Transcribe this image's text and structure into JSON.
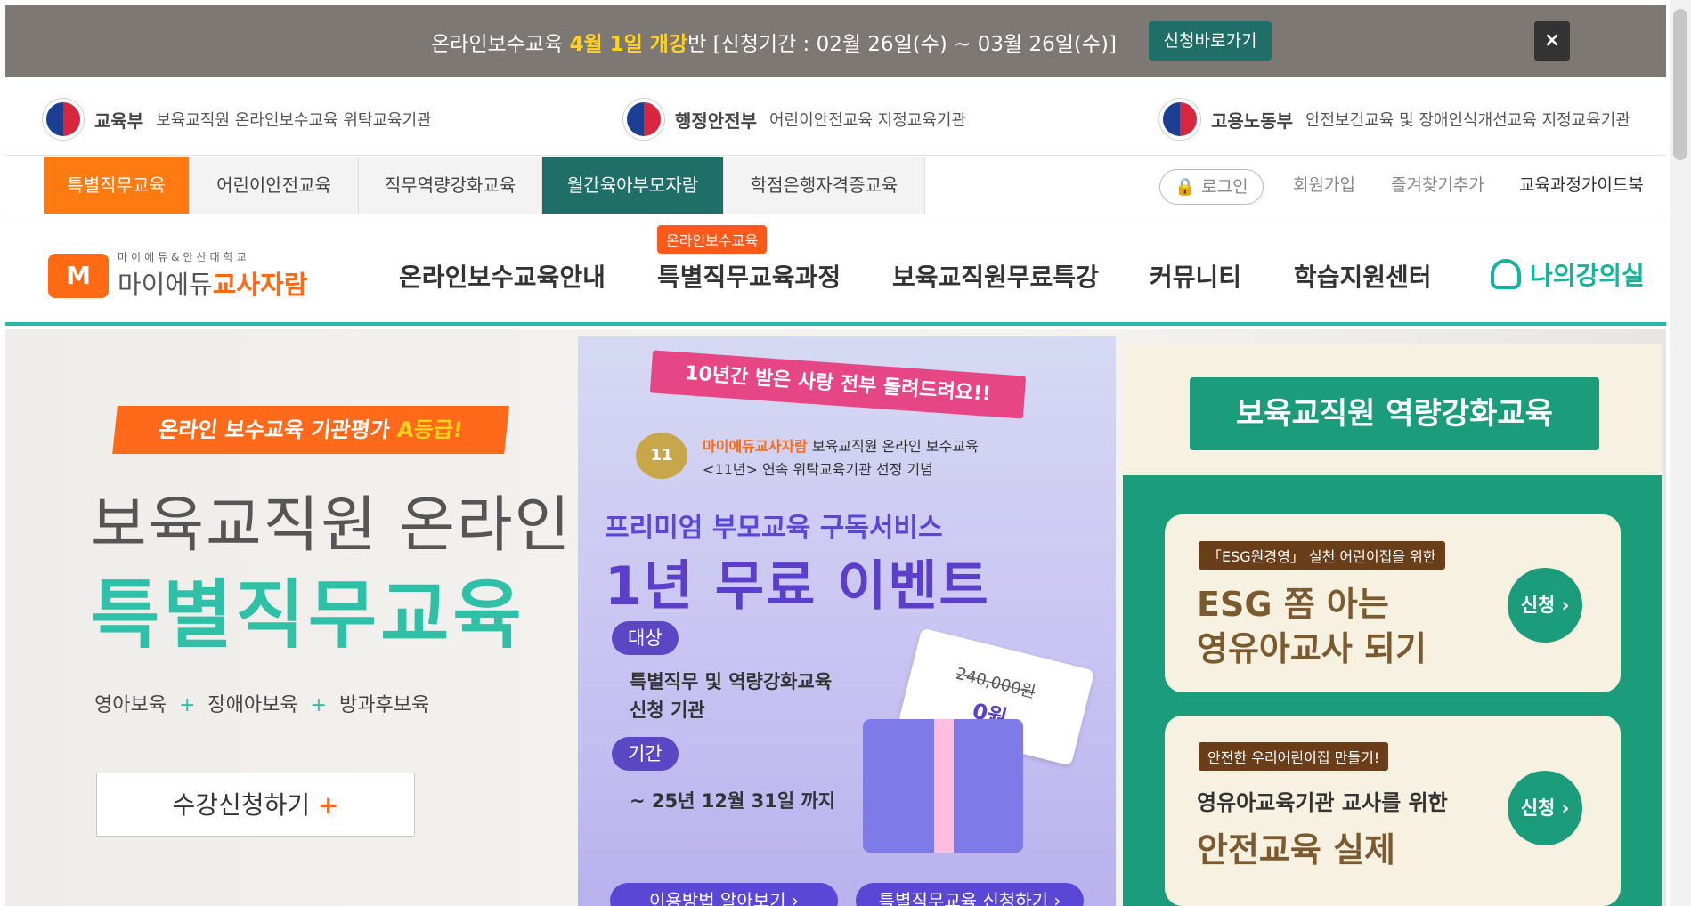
{
  "topbar": {
    "msg_pre": "온라인보수교육 ",
    "msg_bold": "4월 1일 개강",
    "msg_post": "반 [신청기간 : 02월 26일(수) ~ 03월 26일(수)]",
    "apply_label": "신청바로가기",
    "close_label": "×"
  },
  "gov": [
    {
      "ministry": "교육부",
      "desc": "보육교직원 온라인보수교육 위탁교육기관"
    },
    {
      "ministry": "행정안전부",
      "desc": "어린이안전교육 지정교육기관"
    },
    {
      "ministry": "고용노동부",
      "desc": "안전보건교육 및 장애인식개선교육 지정교육기관"
    }
  ],
  "tabs": [
    "특별직무교육",
    "어린이안전교육",
    "직무역량강화교육",
    "월간육아부모자람",
    "학점은행자격증교육"
  ],
  "util": {
    "login": "로그인",
    "join": "회원가입",
    "bookmark": "즐겨찾기추가",
    "guide": "교육과정가이드북"
  },
  "logo": {
    "mark": "M",
    "small": "마이에듀&안산대학교",
    "name_pre": "마이에듀",
    "name_post": "교사자람"
  },
  "nav": {
    "items": [
      "온라인보수교육안내",
      "특별직무교육과정",
      "보육교직원무료특강",
      "커뮤니티",
      "학습지원센터"
    ],
    "tag": "온라인보수교육",
    "my": "나의강의실"
  },
  "hero": {
    "ribbon_pre": "온라인 보수교육 기관평가 ",
    "ribbon_bold": "A등급!",
    "h1": "보육교직원 온라인 보수교육",
    "h2": "특별직무교육",
    "cats": [
      "영아보육",
      "장애아보육",
      "방과후보육"
    ],
    "plus": "+",
    "apply": "수강신청하기",
    "apply_plus": "+"
  },
  "mid": {
    "ribbon": "10년간 받은 사랑 전부 돌려드려요!!",
    "badge": "11",
    "logo_mark": "마이에듀교사자람",
    "line1": "보육교직원 온라인 보수교육",
    "line2": "<11년> 연속 위탁교육기관 선정 기념",
    "t1": "프리미엄 부모교육 구독서비스",
    "t2": "1년 무료 이벤트",
    "target_label": "대상",
    "target_text1": "특별직무 및 역량강화교육",
    "target_text2": "신청 기관",
    "period_label": "기간",
    "period_text": "~ 25년 12월 31일 까지",
    "price_old": "240,000원",
    "price_new": "0원",
    "btn1": "이용방법 알아보기 ›",
    "btn2": "특별직무교육 신청하기 ›"
  },
  "right": {
    "banner": "보육교직원 역량강화교육",
    "card1": {
      "small": "「ESG원경영」 실천 어린이집을 위한",
      "t1": "ESG 쫌 아는",
      "t2": "영유아교사 되기",
      "go": "신청 ›"
    },
    "card2": {
      "small": "안전한 우리어린이집 만들기!",
      "sub": "영유아교육기관 교사를 위한",
      "t": "안전교육 실제",
      "go": "신청 ›"
    }
  }
}
